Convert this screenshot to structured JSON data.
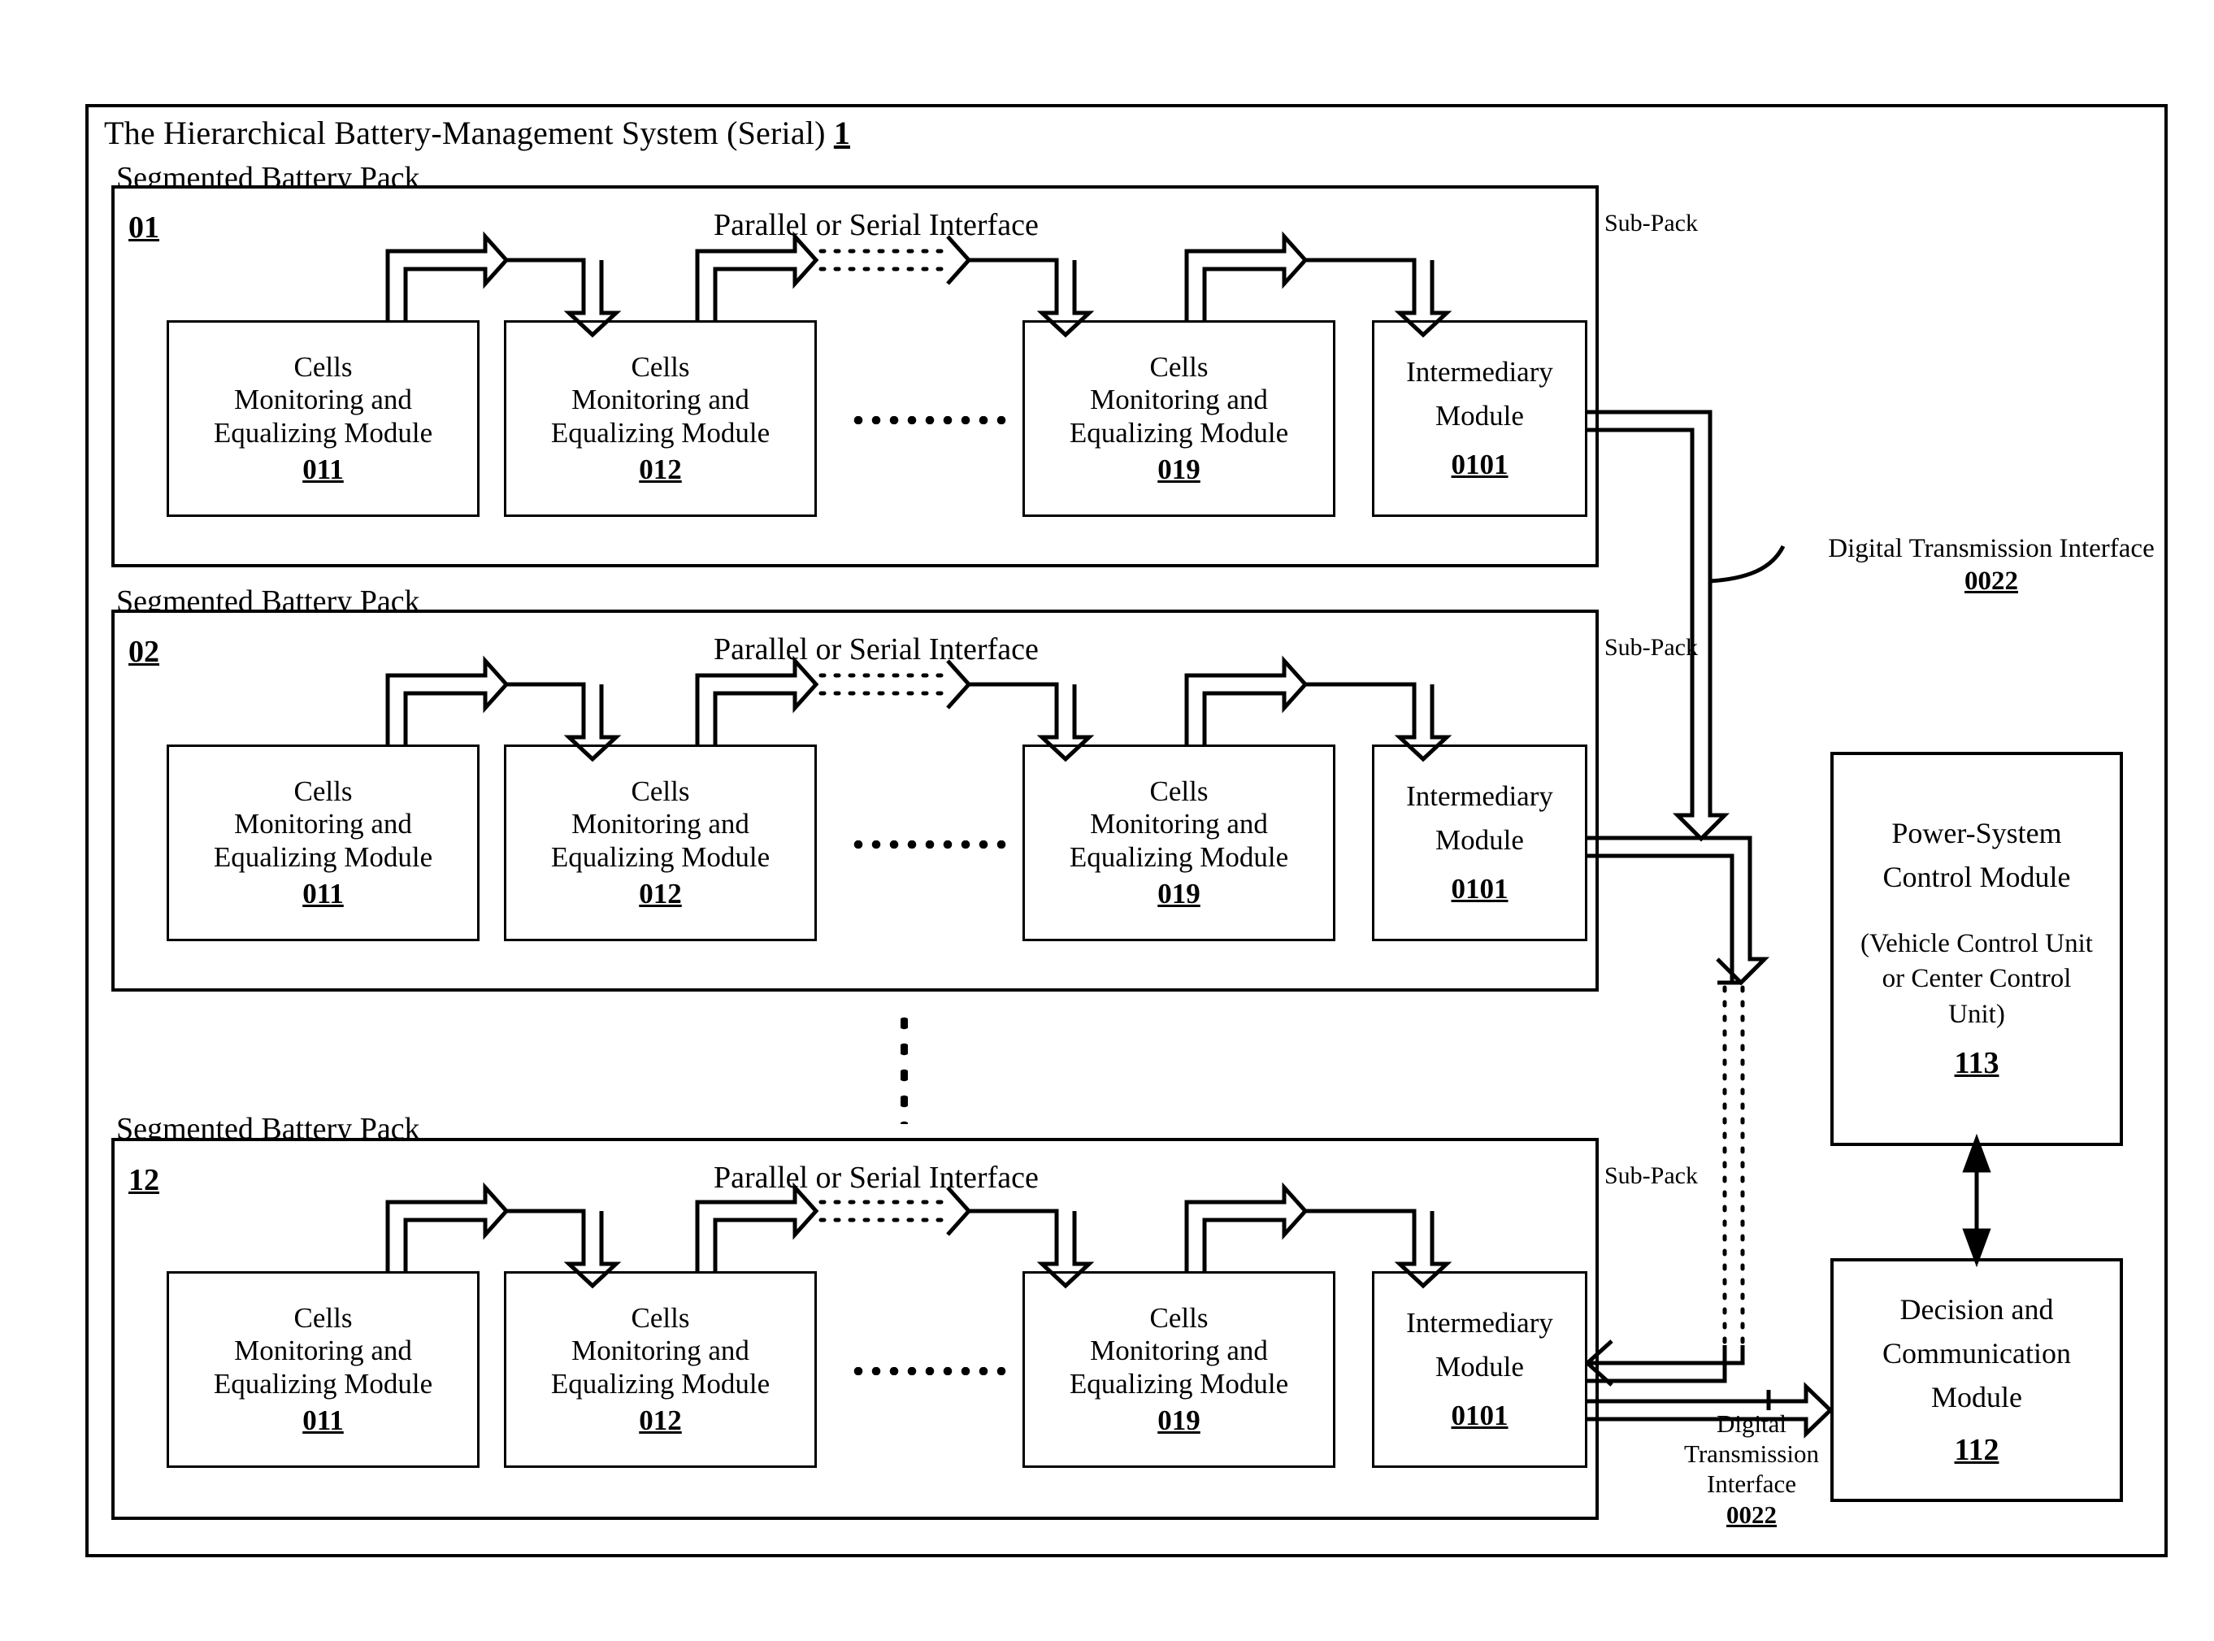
{
  "system": {
    "title": "The Hierarchical Battery-Management System (Serial)",
    "ref": "1"
  },
  "packs": [
    {
      "header": "Segmented Battery Pack",
      "ref": "01",
      "interface_label": "Parallel or Serial Interface",
      "subpack_label": "Sub-Pack",
      "modules": [
        {
          "line1": "Cells",
          "line2": "Monitoring and",
          "line3": "Equalizing Module",
          "num": "011"
        },
        {
          "line1": "Cells",
          "line2": "Monitoring and",
          "line3": "Equalizing Module",
          "num": "012"
        },
        {
          "line1": "Cells",
          "line2": "Monitoring and",
          "line3": "Equalizing Module",
          "num": "019"
        }
      ],
      "intermediary": {
        "line1": "Intermediary",
        "line2": "Module",
        "num": "0101"
      }
    },
    {
      "header": "Segmented Battery Pack",
      "ref": "02",
      "interface_label": "Parallel or Serial Interface",
      "subpack_label": "Sub-Pack",
      "modules": [
        {
          "line1": "Cells",
          "line2": "Monitoring and",
          "line3": "Equalizing Module",
          "num": "011"
        },
        {
          "line1": "Cells",
          "line2": "Monitoring and",
          "line3": "Equalizing Module",
          "num": "012"
        },
        {
          "line1": "Cells",
          "line2": "Monitoring and",
          "line3": "Equalizing Module",
          "num": "019"
        }
      ],
      "intermediary": {
        "line1": "Intermediary",
        "line2": "Module",
        "num": "0101"
      }
    },
    {
      "header": "Segmented Battery Pack",
      "ref": "12",
      "interface_label": "Parallel or Serial Interface",
      "subpack_label": "Sub-Pack",
      "modules": [
        {
          "line1": "Cells",
          "line2": "Monitoring and",
          "line3": "Equalizing Module",
          "num": "011"
        },
        {
          "line1": "Cells",
          "line2": "Monitoring and",
          "line3": "Equalizing Module",
          "num": "012"
        },
        {
          "line1": "Cells",
          "line2": "Monitoring and",
          "line3": "Equalizing Module",
          "num": "019"
        }
      ],
      "intermediary": {
        "line1": "Intermediary",
        "line2": "Module",
        "num": "0101"
      }
    }
  ],
  "annotations": {
    "dti_right": {
      "line1": "Digital Transmission Interface",
      "num": "0022"
    },
    "dti_bottom": {
      "line1": "Digital",
      "line2": "Transmission",
      "line3": "Interface",
      "num": "0022"
    }
  },
  "right_modules": {
    "power_system": {
      "line1": "Power-System",
      "line2": "Control Module",
      "sub1": "(Vehicle Control Unit",
      "sub2": "or Center Control",
      "sub3": "Unit)",
      "num": "113"
    },
    "decision": {
      "line1": "Decision and",
      "line2": "Communication",
      "line3": "Module",
      "num": "112"
    }
  },
  "colors": {
    "stroke": "#000000",
    "background": "#ffffff"
  }
}
